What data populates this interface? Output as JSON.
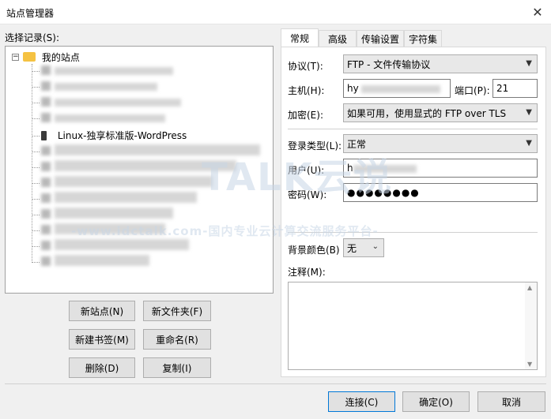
{
  "window": {
    "title": "站点管理器"
  },
  "tree": {
    "label": "选择记录(S):",
    "root": "我的站点",
    "selected": "Linux-独享标准版-WordPress"
  },
  "left_buttons": {
    "new_site": "新站点(N)",
    "new_folder": "新文件夹(F)",
    "new_bookmark": "新建书签(M)",
    "rename": "重命名(R)",
    "delete": "删除(D)",
    "copy": "复制(I)"
  },
  "tabs": [
    "常规",
    "高级",
    "传输设置",
    "字符集"
  ],
  "form": {
    "protocol_label": "协议(T):",
    "protocol_value": "FTP - 文件传输协议",
    "host_label": "主机(H):",
    "host_value": "hy",
    "port_label": "端口(P):",
    "port_value": "21",
    "encryption_label": "加密(E):",
    "encryption_value": "如果可用，使用显式的 FTP over TLS",
    "logon_label": "登录类型(L):",
    "logon_value": "正常",
    "user_label": "用户(U):",
    "user_value": "h",
    "password_label": "密码(W):",
    "password_value": "●●●●●●●●",
    "bgcolor_label": "背景颜色(B)",
    "bgcolor_value": "无",
    "notes_label": "注释(M):"
  },
  "bottom_buttons": {
    "connect": "连接(C)",
    "ok": "确定(O)",
    "cancel": "取消"
  },
  "watermark": {
    "brand": "TALK云说",
    "url": "-www.idctalk.com-国内专业云计算交流服务平台-"
  },
  "icons": {
    "folder": "folder-icon",
    "site": "server-icon",
    "close": "close-icon",
    "dropdown": "chevron-down-icon"
  }
}
